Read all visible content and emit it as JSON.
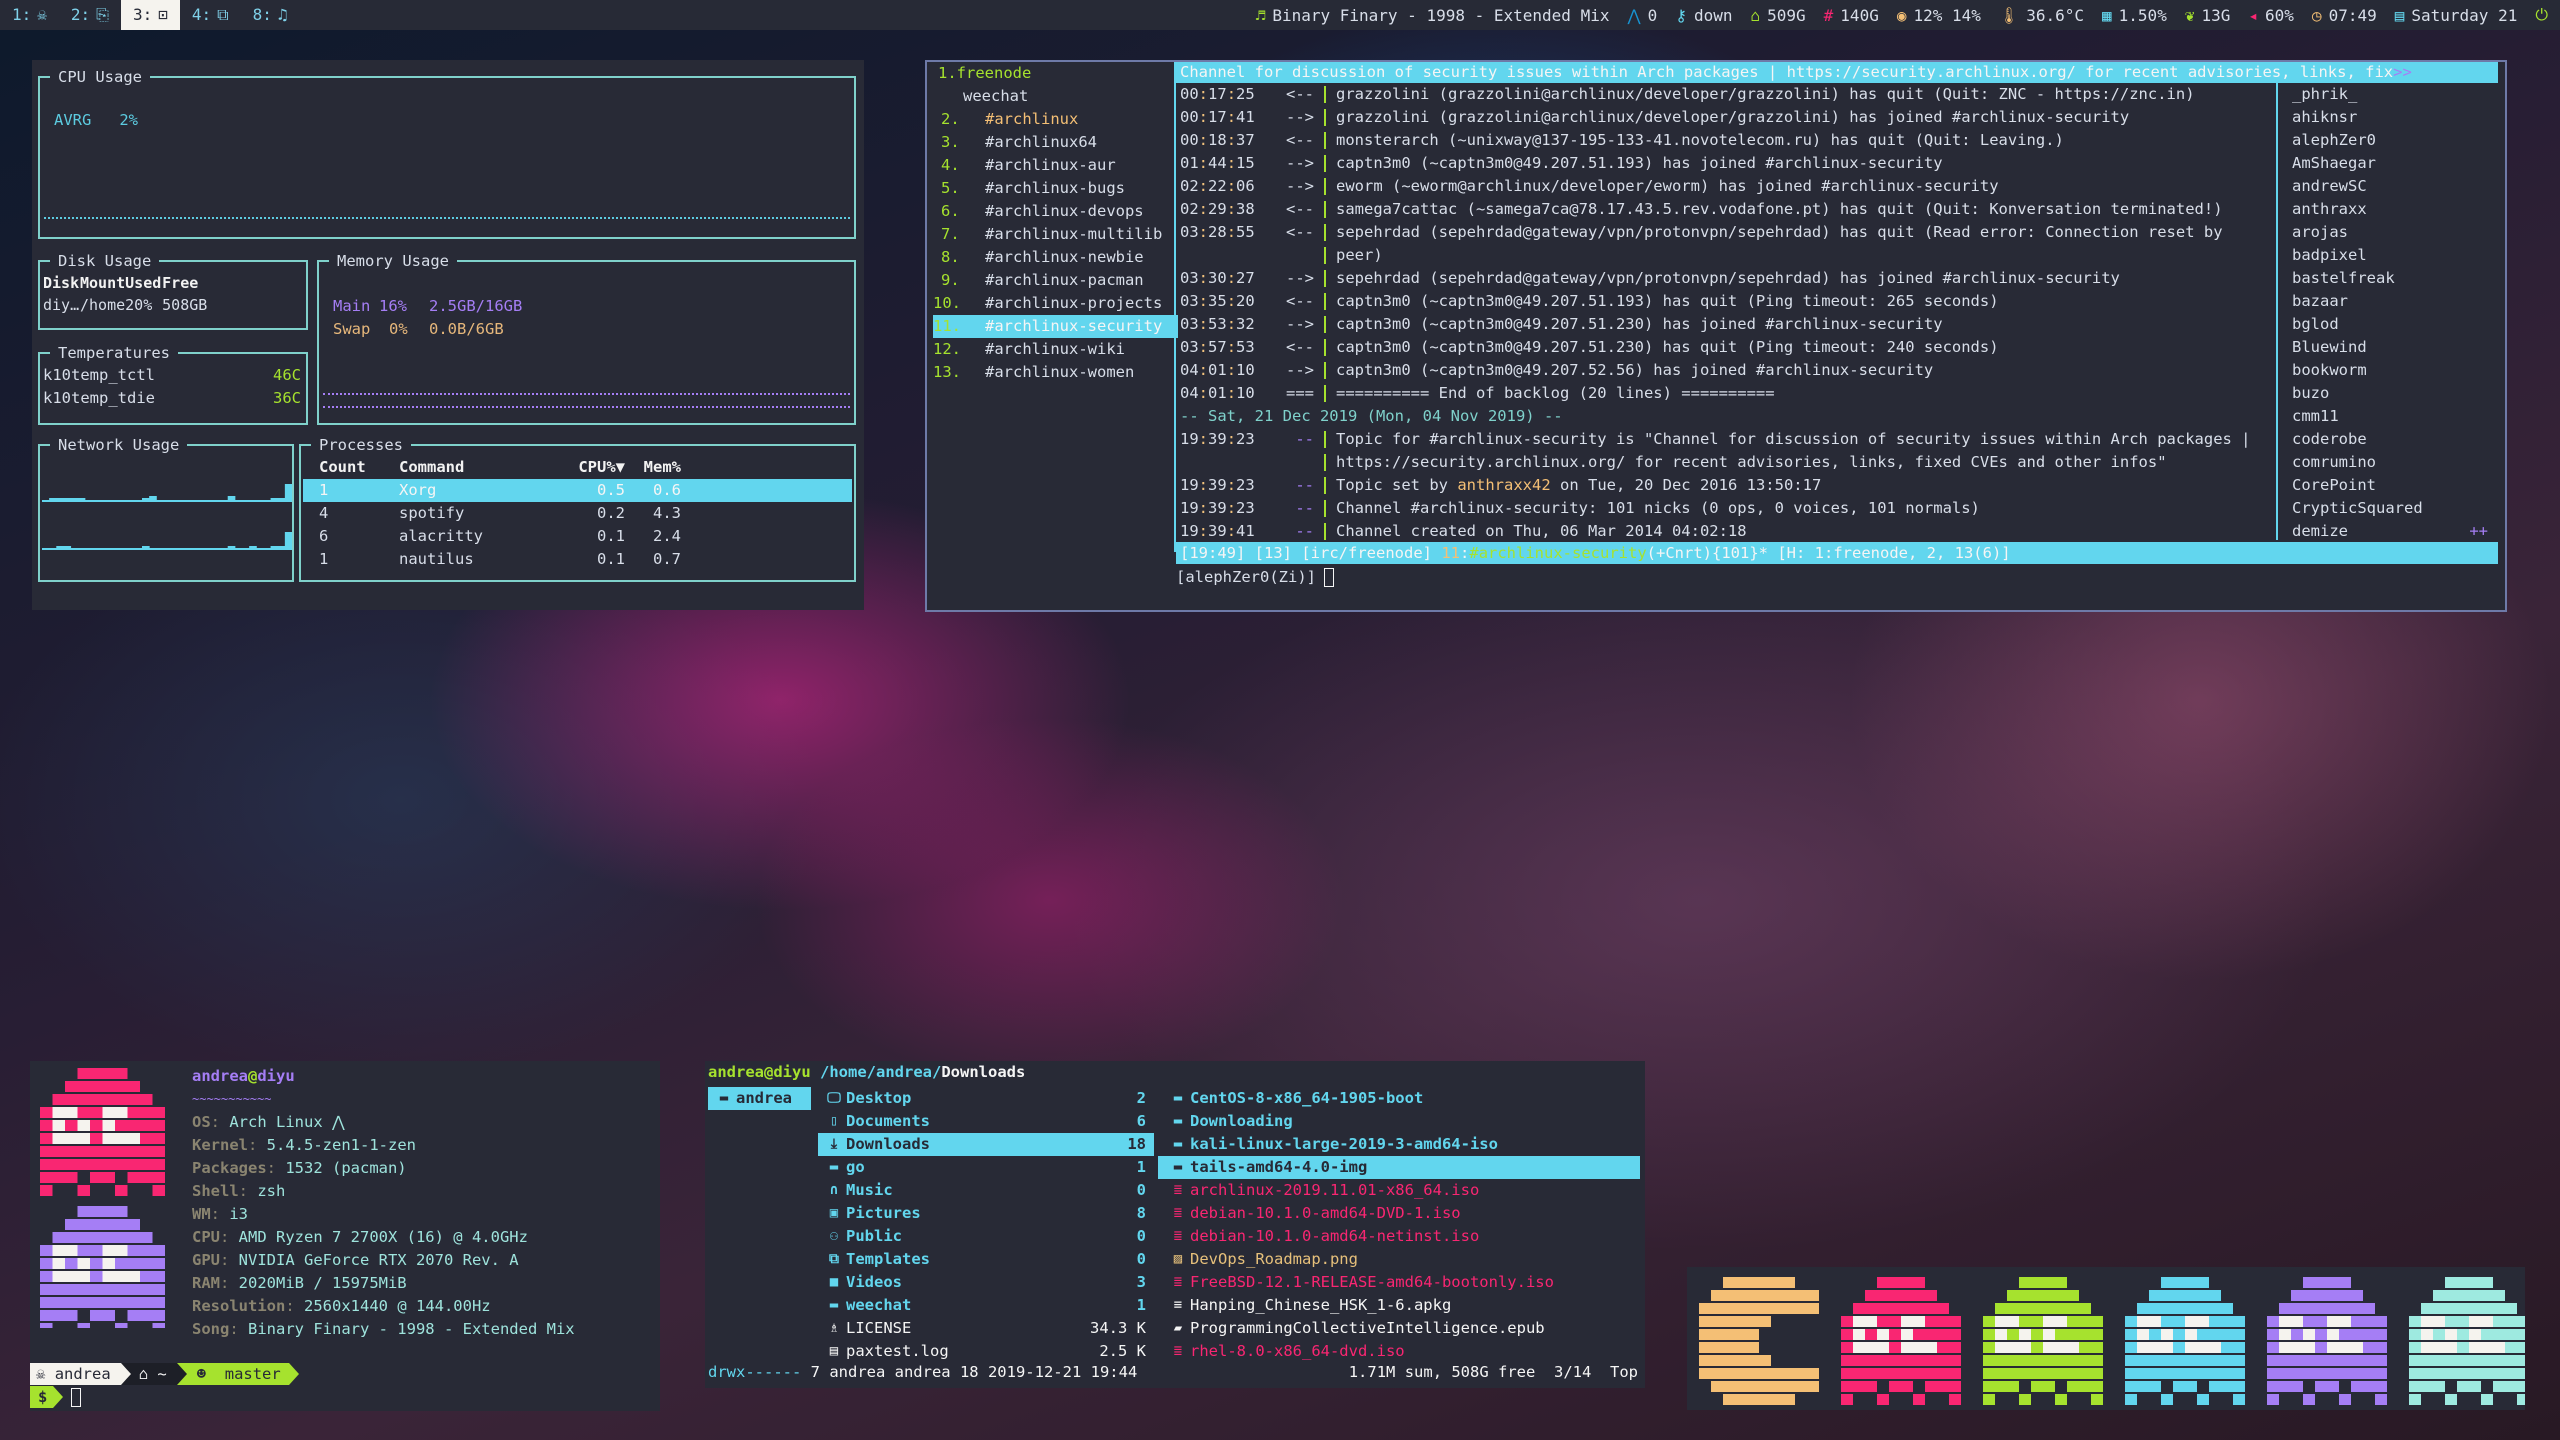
{
  "topbar": {
    "workspaces": [
      {
        "label": "1:",
        "icon": "skull-crossbones-icon",
        "glyph": "☠",
        "active": false
      },
      {
        "label": "2:",
        "icon": "code-file-icon",
        "glyph": "⎘",
        "active": false
      },
      {
        "label": "3:",
        "icon": "terminal-icon",
        "glyph": "⊡",
        "active": true
      },
      {
        "label": "4:",
        "icon": "copy-files-icon",
        "glyph": "⧉",
        "active": false
      },
      {
        "label": "8:",
        "icon": "music-note-icon",
        "glyph": "♫",
        "active": false
      }
    ],
    "status": [
      {
        "name": "now-playing",
        "icon": "music-icon",
        "glyph": "♬",
        "color": "#a6e22e",
        "text": "Binary Finary - 1998 - Extended Mix"
      },
      {
        "name": "updates",
        "icon": "arch-icon",
        "glyph": "⋀",
        "color": "#1793d1",
        "text": "0"
      },
      {
        "name": "vpn",
        "icon": "key-icon",
        "glyph": "⚷",
        "color": "#62d6ee",
        "text": "down"
      },
      {
        "name": "home-disk",
        "icon": "home-icon",
        "glyph": "⌂",
        "color": "#a6e22e",
        "text": "509G"
      },
      {
        "name": "root-disk",
        "icon": "hash-icon",
        "glyph": "#",
        "color": "#f92672",
        "text": "140G"
      },
      {
        "name": "gpu-usage",
        "icon": "eye-icon",
        "glyph": "◉",
        "color": "#f4bf75",
        "text": "12% 14%"
      },
      {
        "name": "temperature",
        "icon": "thermometer-icon",
        "glyph": "🌡",
        "color": "#f4bf75",
        "text": "36.6°C"
      },
      {
        "name": "cpu-load",
        "icon": "chip-icon",
        "glyph": "▦",
        "color": "#62d6ee",
        "text": "1.50%"
      },
      {
        "name": "memory",
        "icon": "leaf-icon",
        "glyph": "❦",
        "color": "#a6e22e",
        "text": "13G"
      },
      {
        "name": "volume",
        "icon": "speaker-icon",
        "glyph": "◂",
        "color": "#f92672",
        "text": "60%"
      },
      {
        "name": "clock",
        "icon": "clock-icon",
        "glyph": "◷",
        "color": "#f4bf75",
        "text": "07:49"
      },
      {
        "name": "date",
        "icon": "calendar-icon",
        "glyph": "▤",
        "color": "#62d6ee",
        "text": "Saturday 21"
      },
      {
        "name": "power",
        "icon": "power-icon",
        "glyph": "⏻",
        "color": "#a6e22e",
        "text": ""
      }
    ]
  },
  "gtop": {
    "cpu": {
      "title": "CPU Usage",
      "label": "AVRG",
      "value": "2%"
    },
    "disk": {
      "title": "Disk Usage",
      "headers": [
        "Disk",
        "Mount",
        "Used",
        "Free"
      ],
      "rows": [
        [
          "diy…",
          "/home",
          "20%",
          "508GB"
        ]
      ]
    },
    "memory": {
      "title": "Memory Usage",
      "rows": [
        {
          "label": "Main",
          "pct": "16%",
          "amount": "2.5GB/16GB",
          "color": "#a57ef5"
        },
        {
          "label": "Swap",
          "pct": "0%",
          "amount": "0.0B/6GB",
          "color": "#e6b77b"
        }
      ]
    },
    "temps": {
      "title": "Temperatures",
      "rows": [
        [
          "k10temp_tctl",
          "46C"
        ],
        [
          "k10temp_tdie",
          "36C"
        ]
      ]
    },
    "network": {
      "title": "Network Usage",
      "rx": [
        1,
        2,
        2,
        2,
        2,
        2,
        1,
        1,
        1,
        1,
        1,
        1,
        1,
        1,
        2,
        3,
        1,
        1,
        1,
        1,
        1,
        1,
        1,
        1,
        1,
        1,
        3,
        1,
        1,
        1,
        1,
        1,
        2,
        2,
        9
      ],
      "tx": [
        1,
        1,
        2,
        2,
        1,
        1,
        1,
        1,
        1,
        1,
        1,
        1,
        1,
        1,
        2,
        1,
        1,
        1,
        1,
        1,
        1,
        1,
        1,
        1,
        1,
        1,
        2,
        1,
        1,
        2,
        1,
        1,
        2,
        2,
        9
      ]
    },
    "processes": {
      "title": "Processes",
      "headers": [
        "Count",
        "Command",
        "CPU%▼",
        "Mem%"
      ],
      "rows": [
        [
          "1",
          "Xorg",
          "0.5",
          "0.6"
        ],
        [
          "4",
          "spotify",
          "0.2",
          "4.3"
        ],
        [
          "6",
          "alacritty",
          "0.1",
          "2.4"
        ],
        [
          "1",
          "nautilus",
          "0.1",
          "0.7"
        ]
      ],
      "selected": 0
    }
  },
  "weechat": {
    "buffers": [
      {
        "num": "1.",
        "name": "freenode",
        "kind": "server"
      },
      {
        "num": "",
        "name": "weechat",
        "kind": "core"
      },
      {
        "num": "2.",
        "name": "#archlinux",
        "kind": "highlight"
      },
      {
        "num": "3.",
        "name": "#archlinux64",
        "kind": "normal"
      },
      {
        "num": "4.",
        "name": "#archlinux-aur",
        "kind": "normal"
      },
      {
        "num": "5.",
        "name": "#archlinux-bugs",
        "kind": "normal"
      },
      {
        "num": "6.",
        "name": "#archlinux-devops",
        "kind": "normal"
      },
      {
        "num": "7.",
        "name": "#archlinux-multilib",
        "kind": "normal"
      },
      {
        "num": "8.",
        "name": "#archlinux-newbie",
        "kind": "normal"
      },
      {
        "num": "9.",
        "name": "#archlinux-pacman",
        "kind": "normal"
      },
      {
        "num": "10.",
        "name": "#archlinux-projects",
        "kind": "normal"
      },
      {
        "num": "11.",
        "name": "#archlinux-security",
        "kind": "active"
      },
      {
        "num": "12.",
        "name": "#archlinux-wiki",
        "kind": "normal"
      },
      {
        "num": "13.",
        "name": "#archlinux-women",
        "kind": "normal"
      }
    ],
    "topic": "Channel for discussion of security issues within Arch packages | https://security.archlinux.org/ for recent advisories, links, fix",
    "topic_more": ">>",
    "lines": [
      {
        "h": "00",
        "m": "17",
        "s": "25",
        "prefix": "<--",
        "type": "quit",
        "msg": "grazzolini (grazzolini@archlinux/developer/grazzolini) has quit (Quit: ZNC - https://znc.in)"
      },
      {
        "h": "00",
        "m": "17",
        "s": "41",
        "prefix": "-->",
        "type": "join",
        "msg": "grazzolini (grazzolini@archlinux/developer/grazzolini) has joined #archlinux-security"
      },
      {
        "h": "00",
        "m": "18",
        "s": "37",
        "prefix": "<--",
        "type": "quit",
        "msg": "monsterarch (~unixway@137-195-133-41.novotelecom.ru) has quit (Quit: Leaving.)"
      },
      {
        "h": "01",
        "m": "44",
        "s": "15",
        "prefix": "-->",
        "type": "join",
        "msg": "captn3m0 (~captn3m0@49.207.51.193) has joined #archlinux-security"
      },
      {
        "h": "02",
        "m": "22",
        "s": "06",
        "prefix": "-->",
        "type": "join",
        "msg": "eworm (~eworm@archlinux/developer/eworm) has joined #archlinux-security"
      },
      {
        "h": "02",
        "m": "29",
        "s": "38",
        "prefix": "<--",
        "type": "quit",
        "msg": "samega7cattac (~samega7ca@78.17.43.5.rev.vodafone.pt) has quit (Quit: Konversation terminated!)"
      },
      {
        "h": "03",
        "m": "28",
        "s": "55",
        "prefix": "<--",
        "type": "quit",
        "msg": "sepehrdad (sepehrdad@gateway/vpn/protonvpn/sepehrdad) has quit (Read error: Connection reset by"
      },
      {
        "h": "",
        "m": "",
        "s": "",
        "prefix": "",
        "type": "cont",
        "msg": "peer)"
      },
      {
        "h": "03",
        "m": "30",
        "s": "27",
        "prefix": "-->",
        "type": "join",
        "msg": "sepehrdad (sepehrdad@gateway/vpn/protonvpn/sepehrdad) has joined #archlinux-security"
      },
      {
        "h": "03",
        "m": "35",
        "s": "20",
        "prefix": "<--",
        "type": "quit",
        "msg": "captn3m0 (~captn3m0@49.207.51.193) has quit (Ping timeout: 265 seconds)"
      },
      {
        "h": "03",
        "m": "53",
        "s": "32",
        "prefix": "-->",
        "type": "join",
        "msg": "captn3m0 (~captn3m0@49.207.51.230) has joined #archlinux-security"
      },
      {
        "h": "03",
        "m": "57",
        "s": "53",
        "prefix": "<--",
        "type": "quit",
        "msg": "captn3m0 (~captn3m0@49.207.51.230) has quit (Ping timeout: 240 seconds)"
      },
      {
        "h": "04",
        "m": "01",
        "s": "10",
        "prefix": "-->",
        "type": "join",
        "msg": "captn3m0 (~captn3m0@49.207.52.56) has joined #archlinux-security"
      },
      {
        "h": "04",
        "m": "01",
        "s": "10",
        "prefix": "===",
        "type": "backlog",
        "msg": "========== End of backlog (20 lines) =========="
      },
      {
        "h": "",
        "m": "",
        "s": "",
        "prefix": "",
        "type": "date",
        "msg": "-- Sat, 21 Dec 2019 (Mon, 04 Nov 2019) --"
      },
      {
        "h": "19",
        "m": "39",
        "s": "23",
        "prefix": "--",
        "type": "info",
        "msg": "Topic for #archlinux-security is \"Channel for discussion of security issues within Arch packages |"
      },
      {
        "h": "",
        "m": "",
        "s": "",
        "prefix": "",
        "type": "cont",
        "msg": "https://security.archlinux.org/ for recent advisories, links, fixed CVEs and other infos\""
      },
      {
        "h": "19",
        "m": "39",
        "s": "23",
        "prefix": "--",
        "type": "topicset",
        "msg_pre": "Topic set by ",
        "nick": "anthraxx42",
        "msg": " on Tue, 20 Dec 2016 13:50:17"
      },
      {
        "h": "19",
        "m": "39",
        "s": "23",
        "prefix": "--",
        "type": "info",
        "msg": "Channel #archlinux-security: 101 nicks (0 ops, 0 voices, 101 normals)"
      },
      {
        "h": "19",
        "m": "39",
        "s": "41",
        "prefix": "--",
        "type": "info",
        "msg": "Channel created on Thu, 06 Mar 2014 04:02:18"
      }
    ],
    "nicks": [
      "_phrik_",
      "ahiknsr",
      "alephZer0",
      "AmShaegar",
      "andrewSC",
      "anthraxx",
      "arojas",
      "badpixel",
      "bastelfreak",
      "bazaar",
      "bglod",
      "Bluewind",
      "bookworm",
      "buzo",
      "cmm11",
      "coderobe",
      "comrumino",
      "CorePoint",
      "CrypticSquared",
      "demize"
    ],
    "nicks_more": "++",
    "statusbar": {
      "time": "[19:49]",
      "count": "[13]",
      "server": "[irc/freenode]",
      "buf_num": "11",
      "channel": "#archlinux-security",
      "modes": "(+Cnrt)",
      "nicks": "{101}*",
      "hotlist": "[H: 1:freenode, 2, 13(6)]"
    },
    "input_prompt": "[alephZer0(Zi)]"
  },
  "neofetch": {
    "user": "andrea",
    "at": "@",
    "host": "diyu",
    "underline": "~~~~~~~~~~~",
    "info": [
      {
        "key": "OS",
        "value": "Arch Linux ⋀"
      },
      {
        "key": "Kernel",
        "value": "5.4.5-zen1-1-zen"
      },
      {
        "key": "Packages",
        "value": "1532 (pacman)"
      },
      {
        "key": "Shell",
        "value": "zsh"
      },
      {
        "key": "WM",
        "value": "i3"
      },
      {
        "key": "CPU",
        "value": "AMD Ryzen 7 2700X (16) @ 4.0GHz"
      },
      {
        "key": "GPU",
        "value": "NVIDIA GeForce RTX 2070 Rev. A"
      },
      {
        "key": "RAM",
        "value": "2020MiB / 15975MiB"
      },
      {
        "key": "Resolution",
        "value": "2560x1440 @ 144.00Hz"
      },
      {
        "key": "Song",
        "value": "Binary Finary - 1998 - Extended Mix"
      }
    ],
    "prompt": {
      "user": "andrea",
      "dir": "~",
      "branch": "master",
      "symbol": "$"
    }
  },
  "ranger": {
    "header_user": "andrea@diyu",
    "header_path": "/home/andrea/",
    "header_dir": "Downloads",
    "parent": [
      {
        "name": "andrea",
        "icon": "folder-icon"
      }
    ],
    "current": [
      {
        "name": "Desktop",
        "count": "2",
        "icon": "desktop-icon",
        "glyph": "🖵",
        "kind": "dir"
      },
      {
        "name": "Documents",
        "count": "6",
        "icon": "document-icon",
        "glyph": "▯",
        "kind": "dir"
      },
      {
        "name": "Downloads",
        "count": "18",
        "icon": "download-icon",
        "glyph": "⤓",
        "kind": "dir",
        "selected": true
      },
      {
        "name": "go",
        "count": "1",
        "icon": "folder-icon",
        "glyph": "▬",
        "kind": "dir"
      },
      {
        "name": "Music",
        "count": "0",
        "icon": "headphones-icon",
        "glyph": "∩",
        "kind": "dir"
      },
      {
        "name": "Pictures",
        "count": "8",
        "icon": "picture-icon",
        "glyph": "▣",
        "kind": "dir"
      },
      {
        "name": "Public",
        "count": "0",
        "icon": "users-icon",
        "glyph": "⚇",
        "kind": "dir"
      },
      {
        "name": "Templates",
        "count": "0",
        "icon": "templates-icon",
        "glyph": "⧉",
        "kind": "dir"
      },
      {
        "name": "Videos",
        "count": "3",
        "icon": "video-icon",
        "glyph": "■",
        "kind": "dir"
      },
      {
        "name": "weechat",
        "count": "1",
        "icon": "folder-icon",
        "glyph": "▬",
        "kind": "dir"
      },
      {
        "name": "LICENSE",
        "count": "34.3 K",
        "icon": "license-icon",
        "glyph": "♗",
        "kind": "file"
      },
      {
        "name": "paxtest.log",
        "count": "2.5 K",
        "icon": "log-icon",
        "glyph": "▤",
        "kind": "file"
      }
    ],
    "preview": [
      {
        "name": "CentOS-8-x86_64-1905-boot",
        "icon": "folder-icon",
        "glyph": "▬",
        "kind": "dir"
      },
      {
        "name": "Downloading",
        "icon": "folder-icon",
        "glyph": "▬",
        "kind": "dir"
      },
      {
        "name": "kali-linux-large-2019-3-amd64-iso",
        "icon": "folder-icon",
        "glyph": "▬",
        "kind": "dir"
      },
      {
        "name": "tails-amd64-4.0-img",
        "icon": "folder-icon",
        "glyph": "▬",
        "kind": "dir",
        "selected": true
      },
      {
        "name": "archlinux-2019.11.01-x86_64.iso",
        "icon": "disk-image-icon",
        "glyph": "≣",
        "kind": "iso"
      },
      {
        "name": "debian-10.1.0-amd64-DVD-1.iso",
        "icon": "disk-image-icon",
        "glyph": "≣",
        "kind": "iso"
      },
      {
        "name": "debian-10.1.0-amd64-netinst.iso",
        "icon": "disk-image-icon",
        "glyph": "≣",
        "kind": "iso"
      },
      {
        "name": "DevOps_Roadmap.png",
        "icon": "image-icon",
        "glyph": "▨",
        "kind": "img"
      },
      {
        "name": "FreeBSD-12.1-RELEASE-amd64-bootonly.iso",
        "icon": "disk-image-icon",
        "glyph": "≣",
        "kind": "iso"
      },
      {
        "name": "Hanping_Chinese_HSK_1-6.apkg",
        "icon": "text-file-icon",
        "glyph": "≡",
        "kind": "plain"
      },
      {
        "name": "ProgrammingCollectiveIntelligence.epub",
        "icon": "book-icon",
        "glyph": "▰",
        "kind": "plain"
      },
      {
        "name": "rhel-8.0-x86_64-dvd.iso",
        "icon": "disk-image-icon",
        "glyph": "≣",
        "kind": "iso"
      }
    ],
    "footer_perms": "drwx------",
    "footer_info": " 7 andrea andrea 18 2019-12-21 19:44",
    "footer_right": "1.71M sum, 508G free  3/14  Top"
  },
  "sprites": [
    {
      "kind": "pacman",
      "color": "#f4bf75"
    },
    {
      "kind": "ghost",
      "color": "#f92672"
    },
    {
      "kind": "ghost",
      "color": "#a6e22e"
    },
    {
      "kind": "ghost",
      "color": "#62d6ee"
    },
    {
      "kind": "ghost",
      "color": "#a57ef5"
    },
    {
      "kind": "ghost",
      "color": "#9eeae0"
    }
  ],
  "neofetch_ghosts": [
    {
      "kind": "ghost",
      "color": "#f92672"
    },
    {
      "kind": "ghost",
      "color": "#a57ef5"
    }
  ]
}
